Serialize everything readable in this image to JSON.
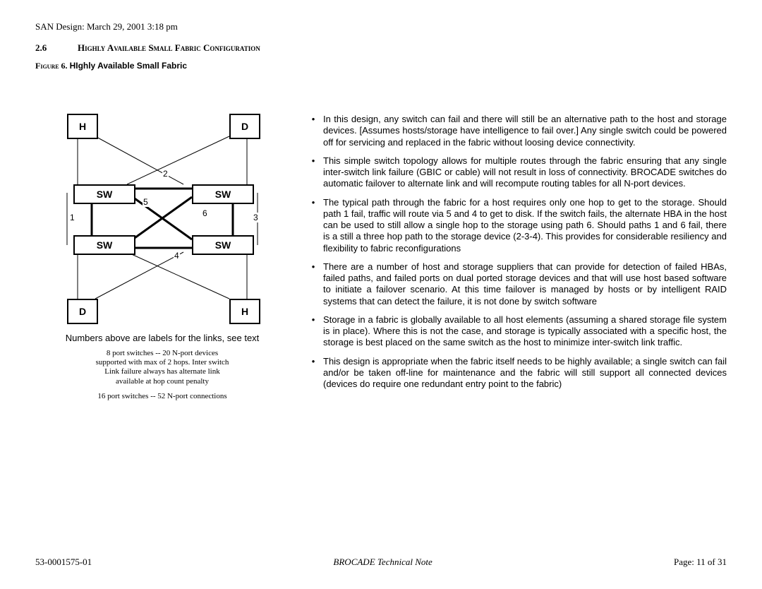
{
  "header": "SAN Design:  March 29, 2001 3:18 pm",
  "section": {
    "num": "2.6",
    "title": "Highly Available Small Fabric Configuration"
  },
  "figure": {
    "label": "Figure  6.",
    "title": "HIghly Available Small Fabric"
  },
  "diagram": {
    "nodes": {
      "H1": "H",
      "D1": "D",
      "SW1": "SW",
      "SW2": "SW",
      "SW3": "SW",
      "SW4": "SW",
      "D2": "D",
      "H2": "H"
    },
    "linkLabels": {
      "l1": "1",
      "l2": "2",
      "l3": "3",
      "l4": "4",
      "l5": "5",
      "l6": "6"
    }
  },
  "caption1": "Numbers above are labels for the links, see text",
  "caption2a": "8 port switches -- 20 N-port devices",
  "caption2b": "supported with max of 2 hops. Inter switch",
  "caption2c": "Link failure always has alternate link",
  "caption2d": "available at hop count penalty",
  "caption3": "16 port switches -- 52 N-port connections",
  "bullets": [
    "In this design, any switch can fail and there will still be an alternative path to the host and storage devices. [Assumes hosts/storage have intelligence to fail over.] Any single switch could be powered off for servicing and replaced in the fabric without loosing device connectivity.",
    "This simple switch topology allows for multiple routes through the fabric ensuring that any single inter-switch link failure (GBIC or cable) will not result in loss of connectivity. BROCADE switches do automatic failover to alternate link and will recompute routing tables for all N-port devices.",
    "The typical path through the fabric for a host requires only one hop to get to the storage. Should path 1 fail, traffic will route via 5 and 4 to get to disk. If the switch fails, the alternate HBA in the host can be used to still allow a single hop to the storage using path 6. Should paths 1 and 6 fail, there is a still a three hop path to the storage device (2-3-4). This provides for considerable resiliency and flexibility to fabric reconfigurations",
    "There are a number of host and storage suppliers that can provide for detection of failed HBAs, failed paths, and failed ports on dual ported storage devices and that will use host based software to initiate a failover scenario. At this time failover is managed by hosts or by intelligent RAID systems that can detect the failure, it is not done by switch software",
    "Storage in a fabric is globally available to all host elements (assuming a shared storage file system is in place). Where this is not the case, and storage is typically associated with a specific host, the storage is best placed on the same switch as the host to minimize inter-switch link traffic.",
    "This design is appropriate when the fabric itself needs to be highly available; a single switch can fail and/or be taken off-line for maintenance and the fabric will still support all connected devices (devices do require one redundant entry point to the fabric)"
  ],
  "footer": {
    "left": "53-0001575-01",
    "mid": "BROCADE Technical Note",
    "right": "Page:   11 of 31"
  }
}
